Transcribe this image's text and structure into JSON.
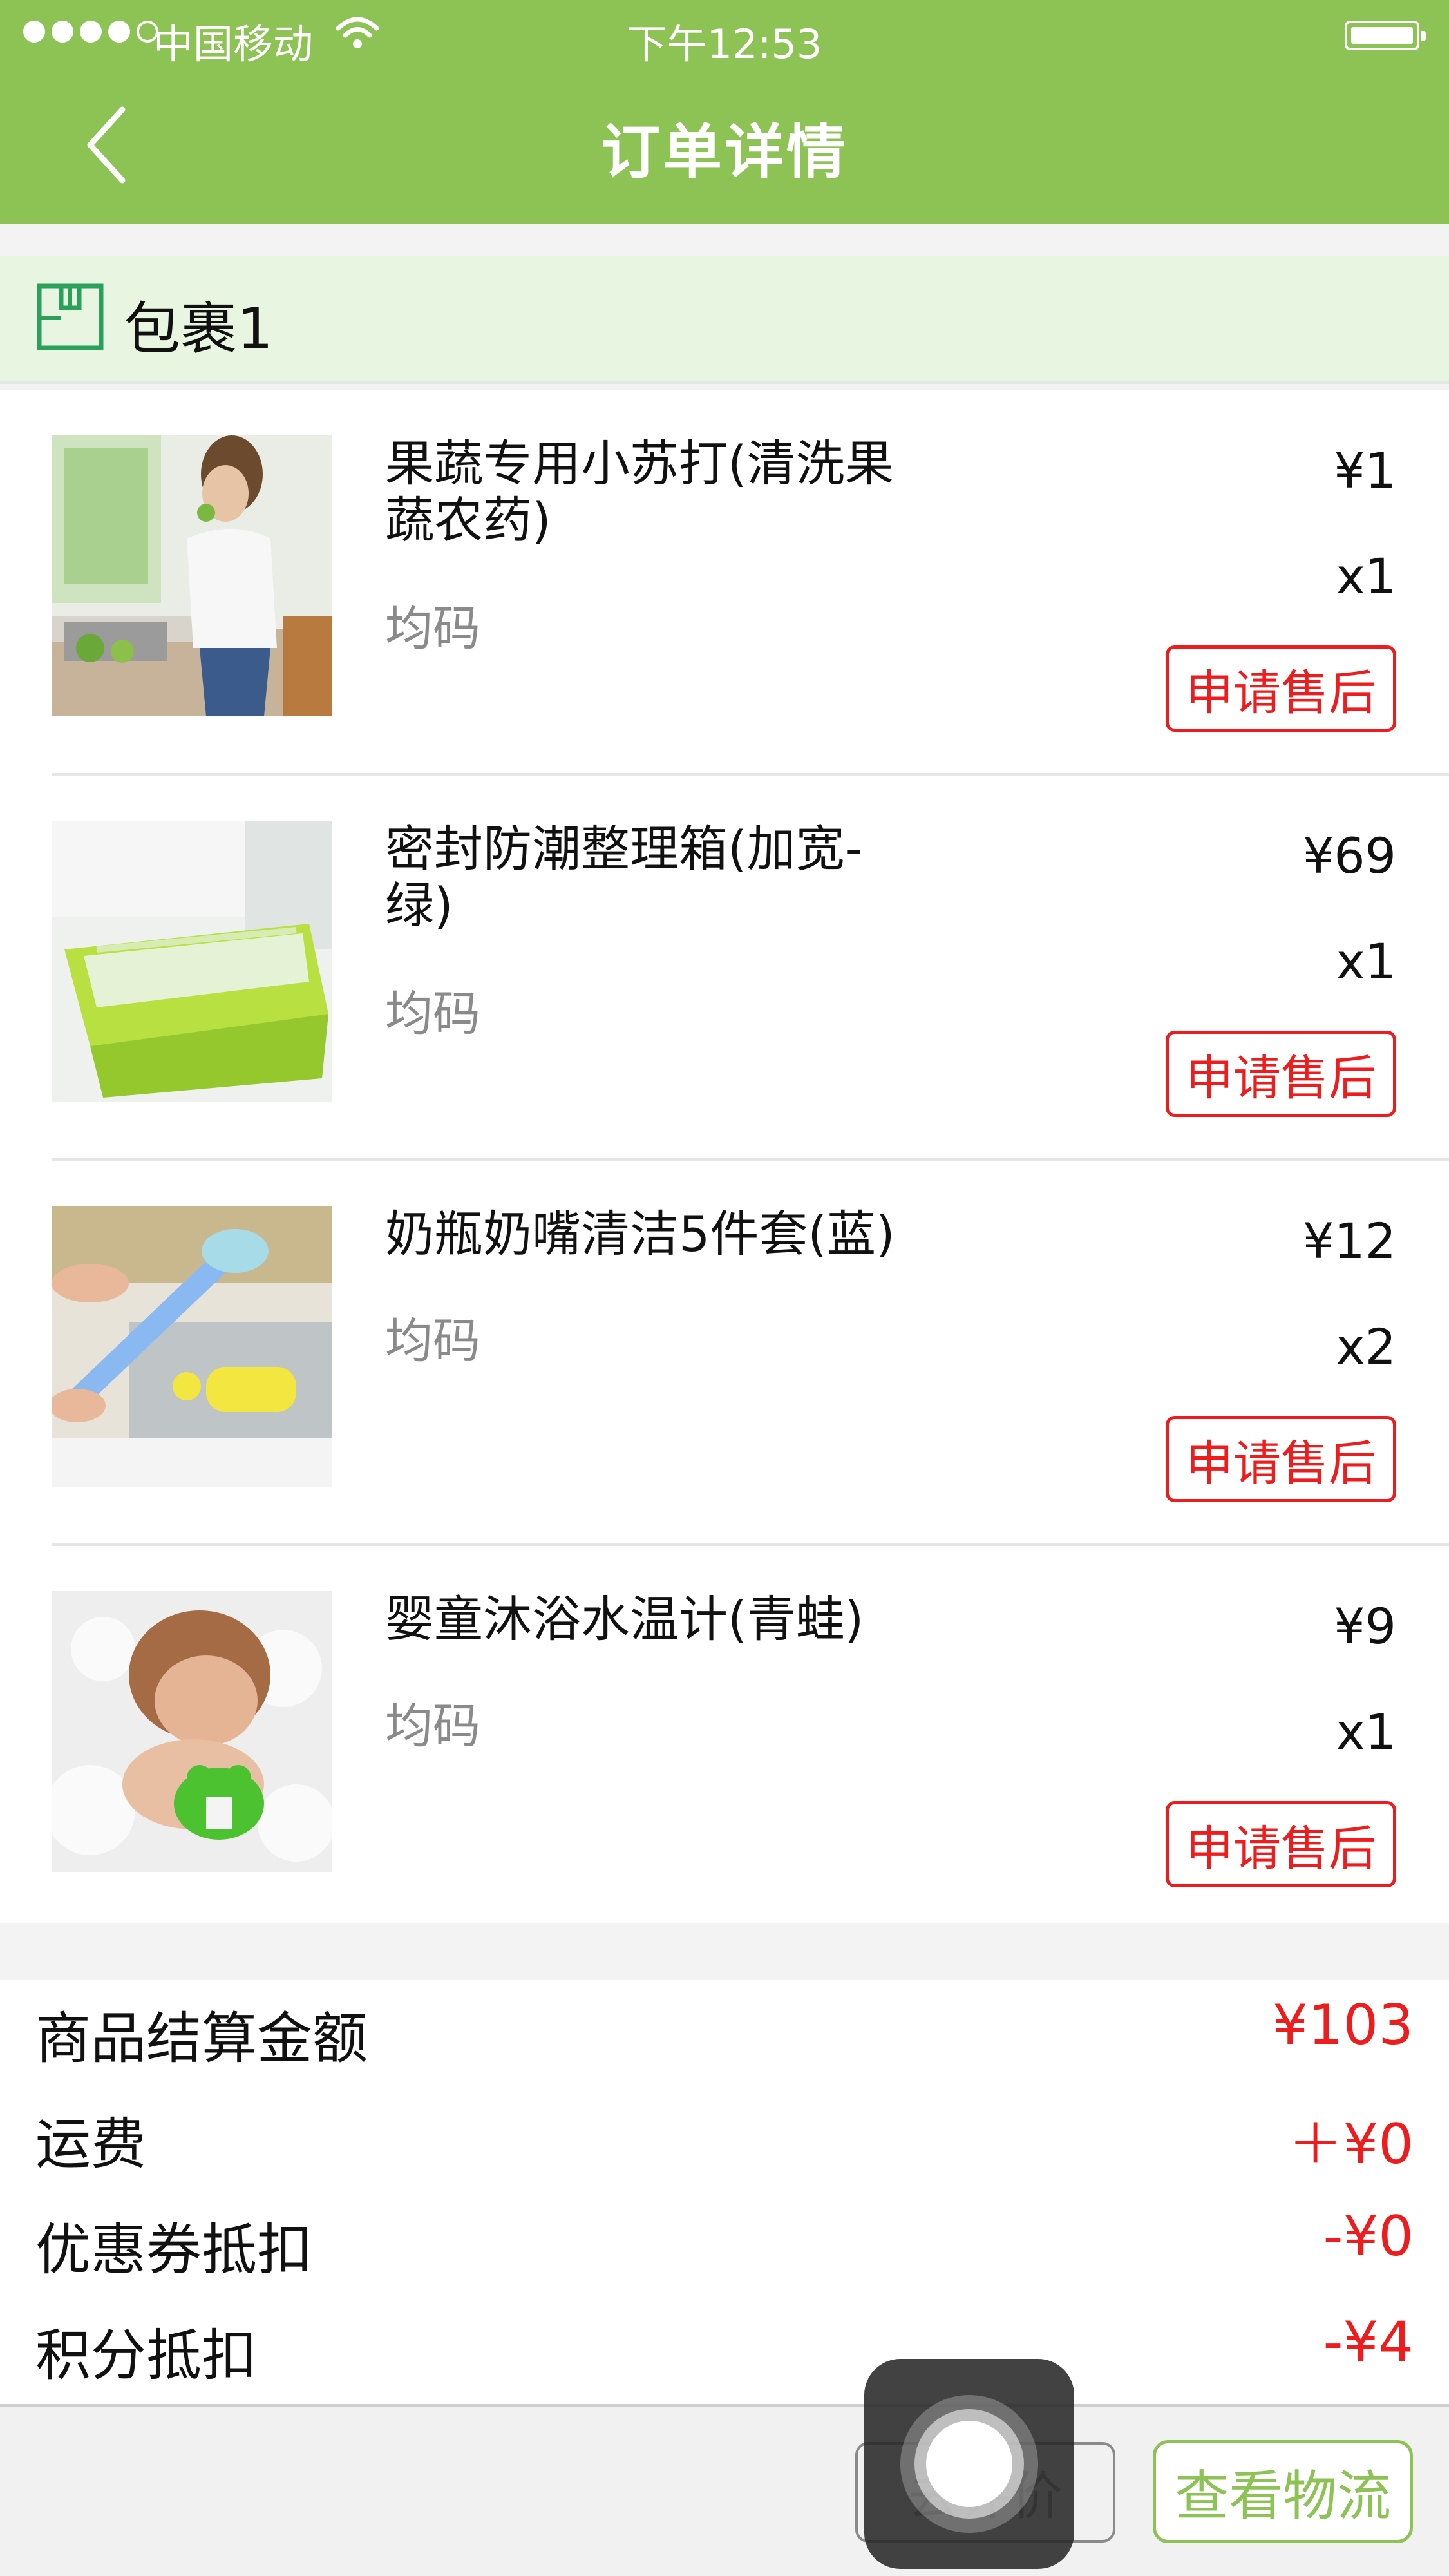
{
  "status_bar": {
    "carrier": "中国移动",
    "time": "下午12:53"
  },
  "nav": {
    "title": "订单详情",
    "back_icon": "chevron-left-icon"
  },
  "package": {
    "label": "包裹1",
    "icon": "package-box-icon"
  },
  "items": [
    {
      "name": "果蔬专用小苏打(清洗果蔬农药)",
      "spec": "均码",
      "price": "¥1",
      "qty": "x1",
      "action": "申请售后",
      "image": "woman-eating-apple-kitchen"
    },
    {
      "name": "密封防潮整理箱(加宽-绿)",
      "spec": "均码",
      "price": "¥69",
      "qty": "x1",
      "action": "申请售后",
      "image": "green-storage-box"
    },
    {
      "name": "奶瓶奶嘴清洁5件套(蓝)",
      "spec": "均码",
      "price": "¥12",
      "qty": "x2",
      "action": "申请售后",
      "image": "bottle-brush-sink"
    },
    {
      "name": "婴童沐浴水温计(青蛙)",
      "spec": "均码",
      "price": "¥9",
      "qty": "x1",
      "action": "申请售后",
      "image": "baby-bath-frog-thermometer"
    }
  ],
  "summary": [
    {
      "label": "商品结算金额",
      "value": "¥103"
    },
    {
      "label": "运费",
      "value": "＋¥0"
    },
    {
      "label": "优惠券抵扣",
      "value": "-¥0"
    },
    {
      "label": "积分抵扣",
      "value": "-¥4"
    }
  ],
  "bottom_actions": {
    "review": "去评价",
    "logistics": "查看物流"
  },
  "colors": {
    "brand_green": "#8dc255",
    "accent_red": "#ee1c1c"
  }
}
